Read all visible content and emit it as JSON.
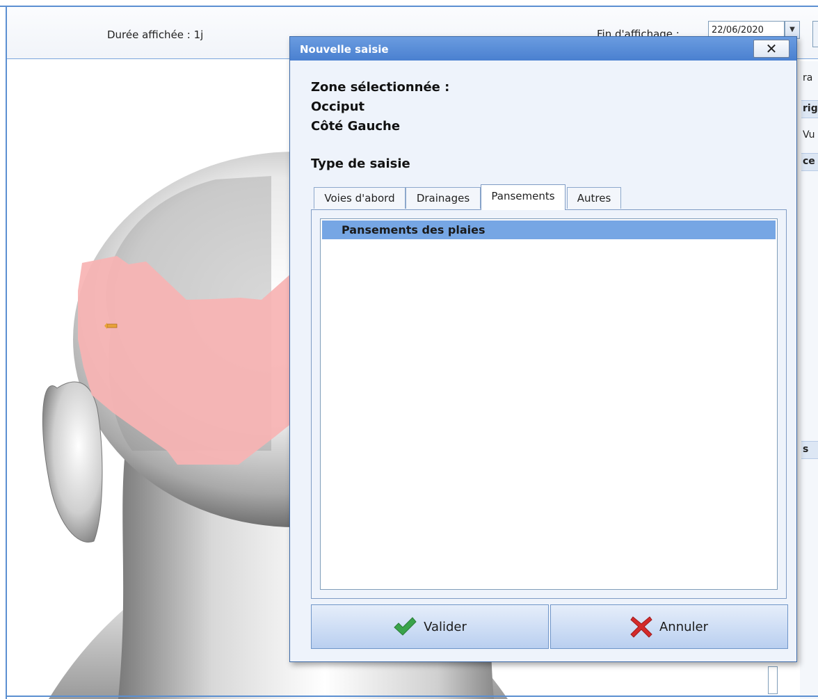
{
  "toolbar": {
    "duration_label": "Durée affichée : 1j",
    "end_label": "Fin d'affichage :",
    "end_date": "22/06/2020"
  },
  "side_panel": {
    "fragments": [
      "ra",
      "rig",
      "Vu",
      "ce",
      "s"
    ]
  },
  "dialog": {
    "title": "Nouvelle saisie",
    "close_label": "✕",
    "zone_label": "Zone sélectionnée :",
    "zone_lines": [
      "Occiput",
      "Côté Gauche"
    ],
    "type_label": "Type de saisie",
    "tabs": [
      {
        "label": "Voies d'abord",
        "active": false
      },
      {
        "label": "Drainages",
        "active": false
      },
      {
        "label": "Pansements",
        "active": true
      },
      {
        "label": "Autres",
        "active": false
      }
    ],
    "list_items": [
      "Pansements des plaies"
    ],
    "validate_label": "Valider",
    "cancel_label": "Annuler"
  },
  "colors": {
    "titlebar": "#5a8ed8",
    "selection": "#76a6e4",
    "highlight_zone": "#f5b5b5",
    "check_icon": "#3aa34a",
    "cross_icon": "#d42a2a"
  },
  "icons": {
    "validate": "check-icon",
    "cancel": "cross-icon",
    "close": "close-icon",
    "marker": "arrow-marker-icon"
  }
}
